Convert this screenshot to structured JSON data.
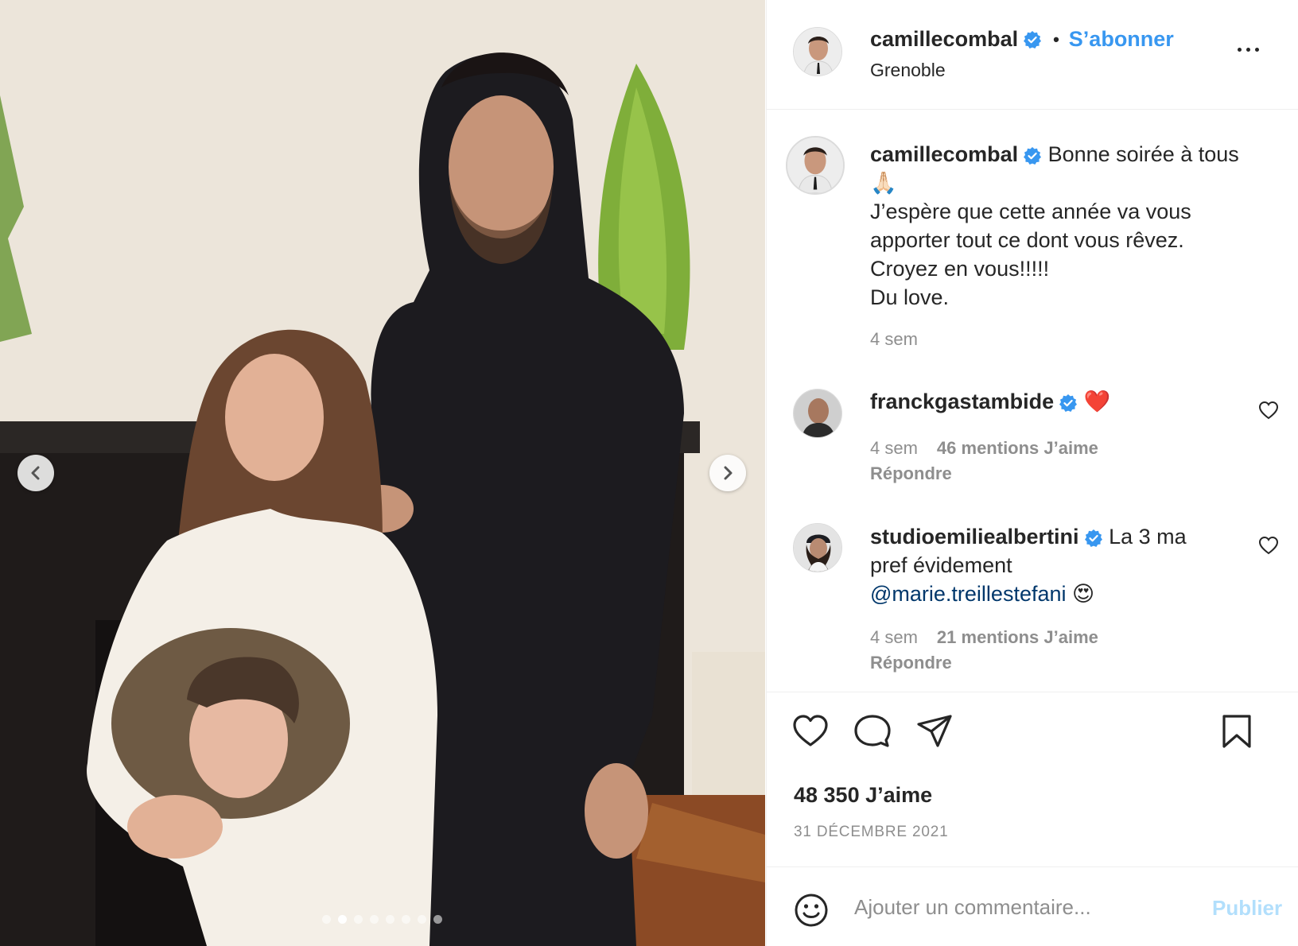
{
  "header": {
    "username": "camillecombal",
    "separator": "•",
    "follow_label": "S’abonner",
    "location": "Grenoble"
  },
  "caption": {
    "username": "camillecombal",
    "text_line1": "Bonne soirée à tous",
    "emoji": "🙏🏻",
    "text_rest": "J’espère que cette année va vous apporter tout ce dont vous rêvez. Croyez en vous!!!!! Du love.",
    "line_a": "J’espère que cette année va vous",
    "line_b": "apporter tout ce dont vous rêvez.",
    "line_c": "Croyez en vous!!!!!",
    "line_d": "Du love.",
    "age": "4 sem"
  },
  "comments": [
    {
      "username": "franckgastambide",
      "text": "❤️",
      "age": "4 sem",
      "likes": "46 mentions J’aime",
      "reply_label": "Répondre"
    },
    {
      "username": "studioemiliealbertini",
      "text_part1": "La 3 ma",
      "text_part2": "pref évidement",
      "mention": "@marie.treillestefani",
      "emoji": "😍",
      "age": "4 sem",
      "likes": "21 mentions J’aime",
      "reply_label": "Répondre"
    }
  ],
  "actions": {
    "likes_count": "48 350 J’aime",
    "date": "31 DÉCEMBRE 2021"
  },
  "add_comment": {
    "placeholder": "Ajouter un commentaire...",
    "publish_label": "Publier"
  },
  "carousel": {
    "slide_count": 8,
    "active_index": 1
  },
  "colors": {
    "accent": "#3897f0",
    "verified": "#3897f0",
    "muted": "#8e8e8e",
    "publish_disabled": "#b2dffc"
  },
  "icons": {
    "verified": "verified-badge-icon",
    "like": "heart-icon",
    "comment": "comment-icon",
    "share": "paper-plane-icon",
    "save": "bookmark-icon",
    "emoji": "smiley-icon",
    "more": "more-horizontal-icon",
    "prev": "chevron-left-icon",
    "next": "chevron-right-icon"
  }
}
